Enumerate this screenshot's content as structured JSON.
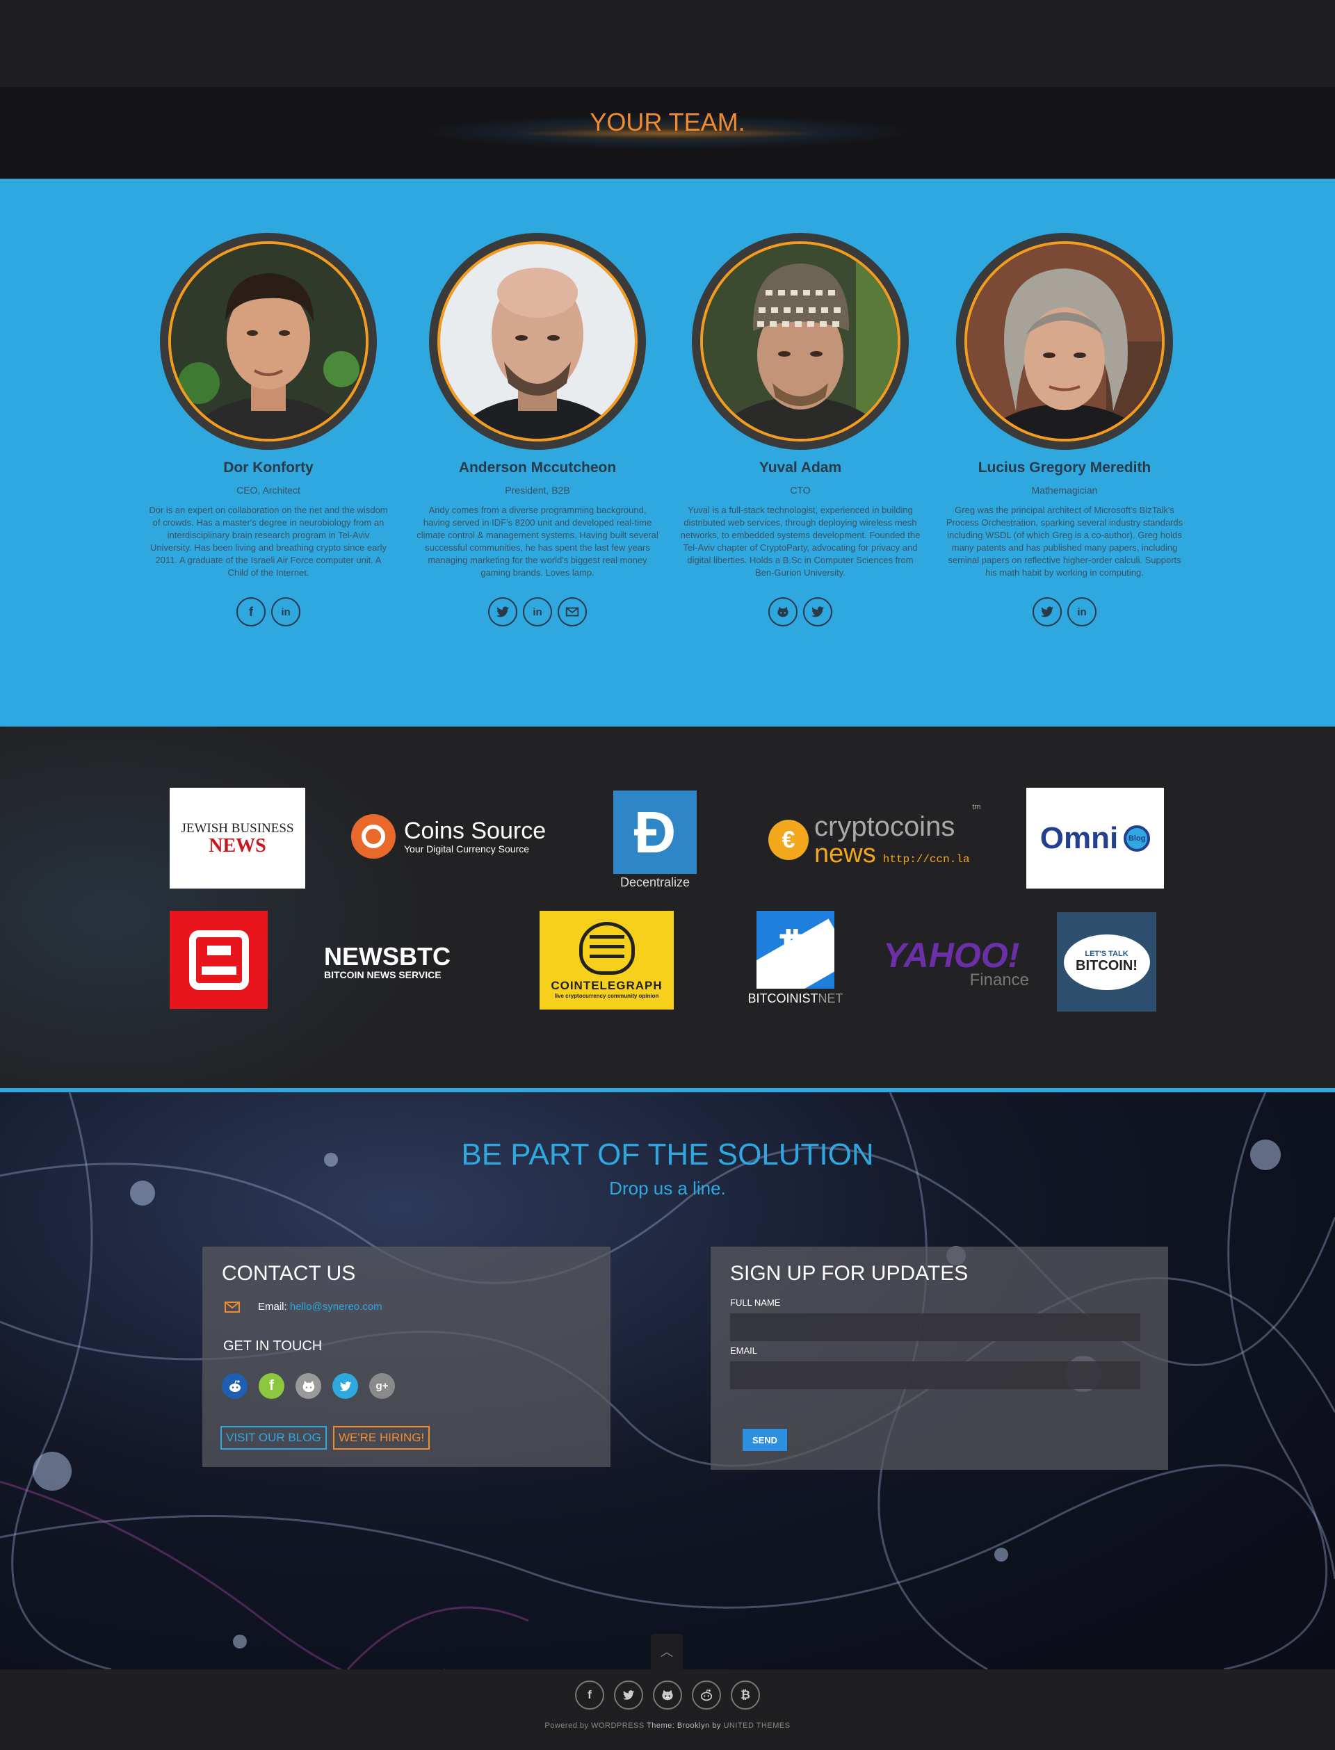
{
  "team": {
    "title": "YOUR TEAM.",
    "members": [
      {
        "name": "Dor Konforty",
        "role": "CEO, Architect",
        "bio": "Dor is an expert on collaboration on the net and the wisdom of crowds. Has a master's degree in neurobiology from an interdisciplinary brain research program in Tel-Aviv University. Has been living and breathing crypto since early 2011. A graduate of the Israeli Air Force computer unit. A Child of the Internet.",
        "socials": [
          "facebook-icon",
          "linkedin-icon"
        ]
      },
      {
        "name": "Anderson Mccutcheon",
        "role": "President, B2B",
        "bio": "Andy comes from a diverse programming background, having served in IDF's 8200 unit and developed real-time climate control & management systems. Having built several successful communities, he has spent the last few years managing marketing for the world's biggest real money gaming brands. Loves lamp.",
        "socials": [
          "twitter-icon",
          "linkedin-icon",
          "email-icon"
        ]
      },
      {
        "name": "Yuval Adam",
        "role": "CTO",
        "bio": "Yuval is a full-stack technologist, experienced in building distributed web services, through deploying wireless mesh networks, to embedded systems development. Founded the Tel-Aviv chapter of CryptoParty, advocating for privacy and digital liberties. Holds a B.Sc in Computer Sciences from Ben-Gurion University.",
        "socials": [
          "github-icon",
          "twitter-icon"
        ]
      },
      {
        "name": "Lucius Gregory Meredith",
        "role": "Mathemagician",
        "bio": "Greg was the principal architect of Microsoft's BizTalk's Process Orchestration, sparking several industry standards including WSDL (of which Greg is a co-author). Greg holds many patents and has published many papers, including seminal papers on reflective higher-order calculi. Supports his math habit by working in computing.",
        "socials": [
          "twitter-icon",
          "linkedin-icon"
        ]
      }
    ]
  },
  "press": {
    "jbn_line1": "JEWISH BUSINESS",
    "jbn_line2": "NEWS",
    "coins_source": "Coins Source",
    "coins_source_tag": "Your Digital Currency Source",
    "decentralize": "Decentralize",
    "cryptocoins_crypto": "crypto",
    "cryptocoins_coins": "coins",
    "cryptocoins_news": "news",
    "cryptocoins_url": "http://ccn.la",
    "cryptocoins_tm": "tm",
    "omni": "Omni",
    "omni_badge": "Blog",
    "newsbtc": "NEWSBTC",
    "newsbtc_tag": "BITCOIN NEWS SERVICE",
    "cointelegraph": "COINTELEGRAPH",
    "cointelegraph_tag": "live cryptocurrency community opinion",
    "bitcoinist": "BITCOINIST",
    "bitcoinist_net": "NET",
    "yahoo": "YAHOO!",
    "yahoo_finance": "Finance",
    "ltb_top": "LET'S TALK",
    "ltb_main": "BITCOIN!"
  },
  "contact": {
    "title": "BE PART OF THE SOLUTION",
    "subtitle": "Drop us a line.",
    "contact_title": "CONTACT US",
    "email_label": "Email:",
    "email_value": "hello@synereo.com",
    "get_in_touch": "GET IN TOUCH",
    "blog_button": "VISIT OUR BLOG",
    "hiring_button": "WE'RE HIRING!",
    "signup_title": "SIGN UP FOR UPDATES",
    "full_name_label": "FULL NAME",
    "email_field_label": "EMAIL",
    "send": "SEND",
    "git_icons": [
      "reddit-icon",
      "facebook-icon",
      "github-icon",
      "twitter-icon",
      "googleplus-icon"
    ]
  },
  "footer": {
    "icons": [
      "facebook-icon",
      "twitter-icon",
      "github-icon",
      "reddit-icon",
      "bitcoin-icon"
    ],
    "credit_powered": "Powered by",
    "credit_wp": "WORDPRESS",
    "credit_theme": "Theme: Brooklyn by",
    "credit_united": "UNITED THEMES"
  },
  "colors": {
    "accent_blue": "#2fa8e0",
    "accent_orange": "#f08c2e",
    "dark": "#1f1f21"
  }
}
